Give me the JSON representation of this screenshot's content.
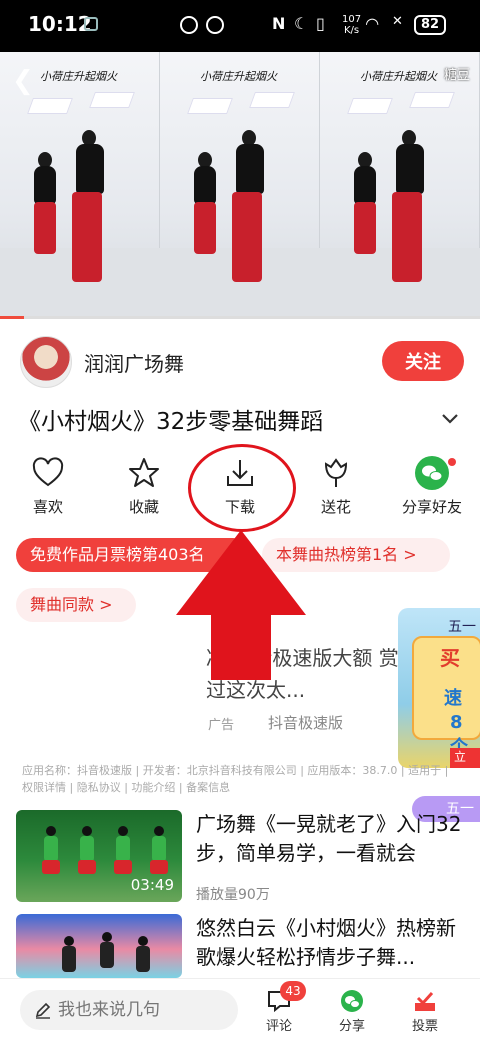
{
  "status_bar": {
    "time": "10:12",
    "network_speed_value": "107",
    "network_speed_unit": "K/s",
    "battery": "82"
  },
  "video": {
    "caption": "小荷庄升起烟火",
    "badge": "糖豆",
    "progress_fraction": 0.05
  },
  "author": {
    "name": "润润广场舞",
    "follow_label": "关注"
  },
  "title": "《小村烟火》32步零基础舞蹈",
  "actions": [
    {
      "label": "喜欢",
      "icon": "heart-icon"
    },
    {
      "label": "收藏",
      "icon": "star-icon"
    },
    {
      "label": "下载",
      "icon": "download-icon"
    },
    {
      "label": "送花",
      "icon": "flower-icon"
    },
    {
      "label": "分享好友",
      "icon": "wechat-icon"
    }
  ],
  "tags": {
    "monthly_rank": "免费作品月票榜第403名",
    "song_rank": "本舞曲热榜第1名 >",
    "same_song": "舞曲同款 >"
  },
  "ad": {
    "text": "冷 抖音极速版大额 赏 ，错过这次太...",
    "label": "广告",
    "source": "抖音极速版",
    "info": "应用名称：抖音极速版 | 开发者：北京抖音科技有限公司 | 应用版本：38.7.0 | 适用于 | 权限详情 | 隐私协议 | 功能介绍 | 备案信息",
    "float_top": "五一",
    "float_a": "买",
    "float_b": "速",
    "float_c": "8个",
    "float_d": "立即",
    "float2": "五一"
  },
  "related": [
    {
      "title": "广场舞《一晃就老了》入门32步，简单易学，一看就会",
      "duration": "03:49",
      "meta": "播放量90万"
    },
    {
      "title": "悠然白云《小村烟火》热榜新歌爆火轻松抒情步子舞...",
      "duration": "",
      "meta": ""
    }
  ],
  "bottom_bar": {
    "comment_placeholder": "我也来说几句",
    "comment_label": "评论",
    "comment_count": "43",
    "share_label": "分享",
    "vote_label": "投票"
  },
  "colors": {
    "accent": "#f0403c",
    "wechat_green": "#2bb34b",
    "annotation_red": "#e0141c"
  }
}
